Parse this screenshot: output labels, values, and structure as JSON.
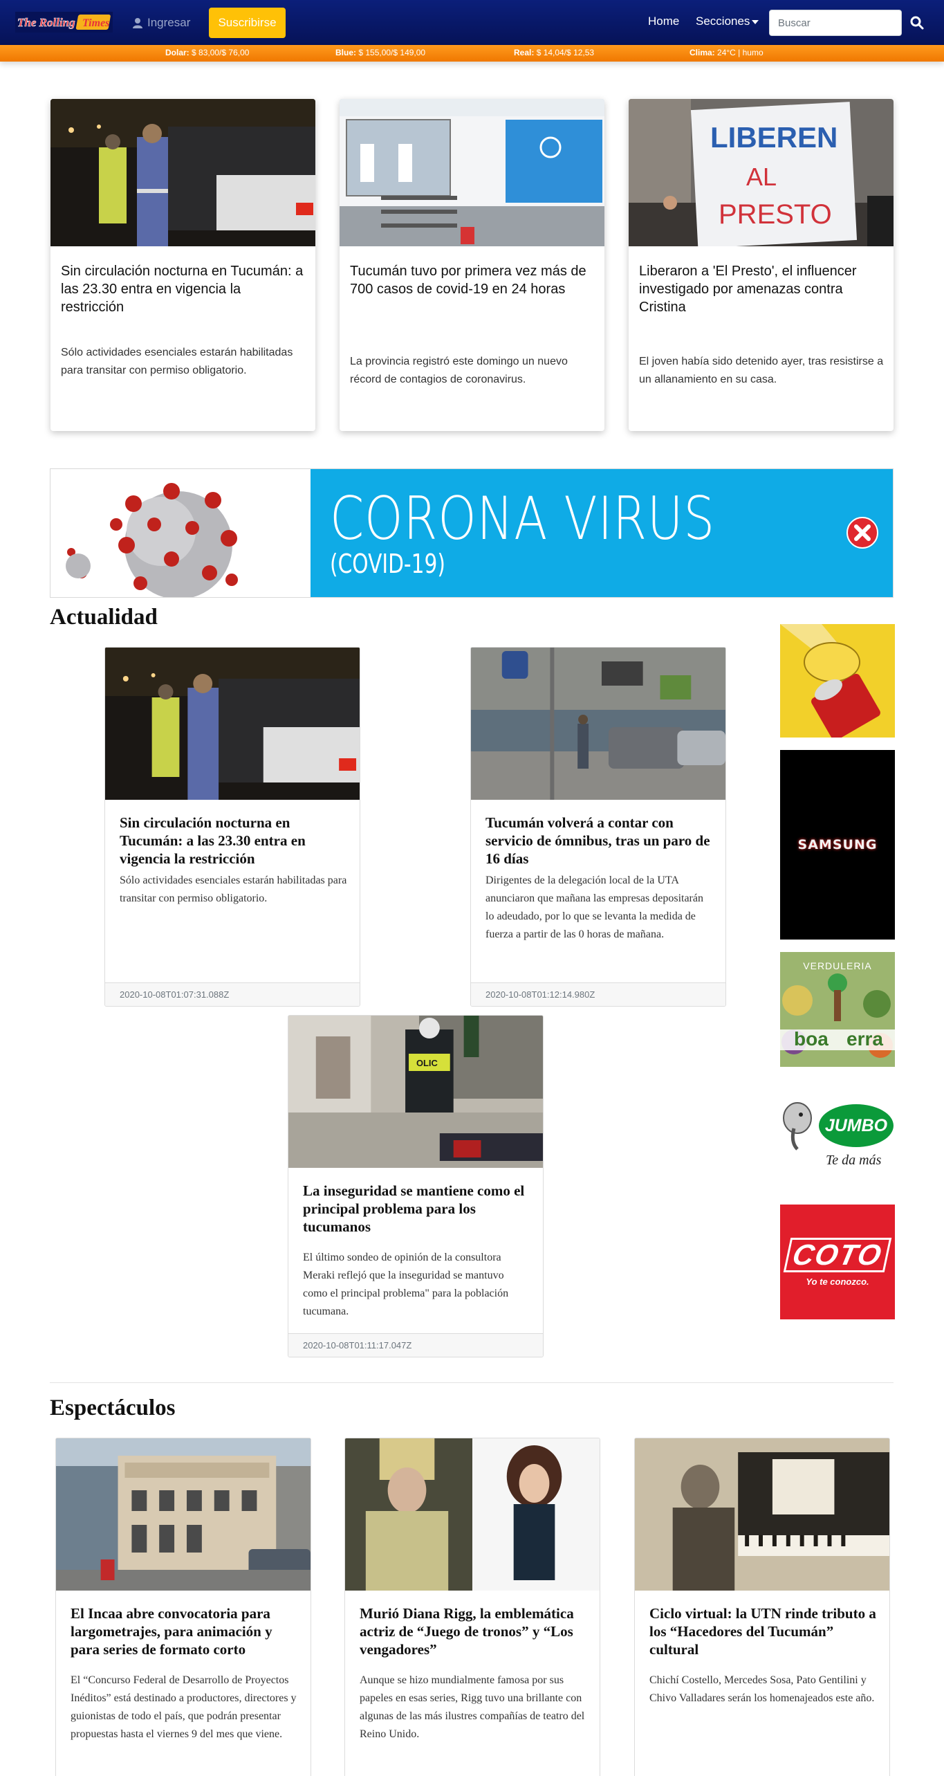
{
  "navbar": {
    "logo_text_1": "The Rolling",
    "logo_text_2": "Times",
    "login_label": "Ingresar",
    "subscribe_label": "Suscribirse",
    "home_label": "Home",
    "sections_label": "Secciones",
    "search_placeholder": "Buscar",
    "colors": {
      "bg": "#061257",
      "accent": "#ffc107"
    }
  },
  "ticker": {
    "dolar_label": "Dolar:",
    "dolar_value": "$ 83,00/$ 76,00",
    "blue_label": "Blue:",
    "blue_value": "$ 155,00/$ 149,00",
    "real_label": "Real:",
    "real_value": "$ 14,04/$ 12,53",
    "clima_label": "Clima:",
    "clima_value": "24°C | humo",
    "color": "#f07800"
  },
  "featured": [
    {
      "title": "Sin circulación nocturna en Tucumán: a las 23.30 entra en vigencia la restricción",
      "summary": "Sólo actividades esenciales estarán habilitadas para transitar con permiso obligatorio."
    },
    {
      "title": "Tucumán tuvo por primera vez más de 700 casos de covid-19 en 24 horas",
      "summary": "La provincia registró este domingo un nuevo récord de contagios de coronavirus."
    },
    {
      "title": "Liberaron a 'El Presto', el influencer investigado por amenazas contra Cristina",
      "summary": "El joven había sido detenido ayer, tras resistirse a un allanamiento en su casa.",
      "image_sign_text_1": "LIBEREN",
      "image_sign_text_2": "AL",
      "image_sign_text_3": "PRESTO"
    }
  ],
  "banner": {
    "title": "CORONA VIRUS",
    "subtitle": "(COVID-19)",
    "color": "#0fabe6"
  },
  "actualidad": {
    "heading": "Actualidad",
    "items": [
      {
        "title": "Sin circulación nocturna en Tucumán: a las 23.30 entra en vigencia la restricción",
        "summary": "Sólo actividades esenciales estarán habilitadas para transitar con permiso obligatorio.",
        "date": "2020-10-08T01:07:31.088Z"
      },
      {
        "title": "Tucumán volverá a contar con servicio de ómnibus, tras un paro de 16 días",
        "summary": "Dirigentes de la delegación local de la UTA anunciaron que mañana las empresas depositarán lo adeudado, por lo que se levanta la medida de fuerza a partir de las 0 horas de mañana.",
        "date": "2020-10-08T01:12:14.980Z"
      },
      {
        "title": "La inseguridad se mantiene como el principal problema para los tucumanos",
        "summary": "El último sondeo de opinión de la consultora Meraki reflejó que la inseguridad se mantuvo como el principal problema\" para la población tucumana.",
        "date": "2020-10-08T01:11:17.047Z",
        "image_text": "OLIC"
      }
    ]
  },
  "ads": {
    "samsung": "SAMSUNG",
    "verduleria_1": "VERDULERIA",
    "verduleria_2": "boa",
    "verduleria_3": "erra",
    "jumbo": "JUMBO",
    "jumbo_tag": "Te da más",
    "coto": "COTO",
    "coto_tag": "Yo te conozco."
  },
  "espectaculos": {
    "heading": "Espectáculos",
    "items": [
      {
        "title": "El Incaa abre convocatoria para largometrajes, para animación y para series de formato corto",
        "summary": "El “Concurso Federal de Desarrollo de Proyectos Inéditos” está destinado a productores, directores y guionistas de todo el país, que podrán presentar propuestas hasta el viernes 9 del mes que viene."
      },
      {
        "title": "Murió Diana Rigg, la emblemática actriz de “Juego de tronos” y “Los vengadores”",
        "summary": "Aunque se hizo mundialmente famosa por sus papeles en esas series, Rigg tuvo una brillante con algunas de las más ilustres compañías de teatro del Reino Unido."
      },
      {
        "title": "Ciclo virtual: la UTN rinde tributo a los “Hacedores del Tucumán” cultural",
        "summary": "Chichí Costello, Mercedes Sosa, Pato Gentilini y Chivo Valladares serán los homenajeados este año."
      }
    ]
  }
}
